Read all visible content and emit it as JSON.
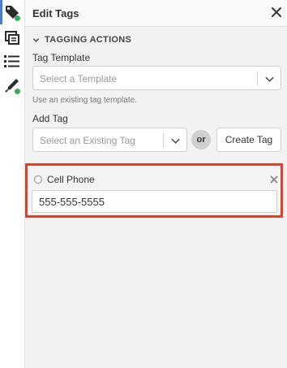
{
  "rail": {
    "items": [
      {
        "icon": "tag-icon",
        "active": true,
        "dot": true
      },
      {
        "icon": "layers-icon",
        "active": false,
        "dot": false
      },
      {
        "icon": "list-icon",
        "active": false,
        "dot": false
      },
      {
        "icon": "pen-icon",
        "active": false,
        "dot": true
      }
    ],
    "accent_color": "#4a7fc1",
    "dot_color": "#3caa5a"
  },
  "header": {
    "title": "Edit Tags",
    "close_icon": "close-icon"
  },
  "section": {
    "title": "TAGGING ACTIONS",
    "expanded": true
  },
  "tag_template": {
    "label": "Tag Template",
    "placeholder": "Select a Template",
    "hint": "Use an existing tag template."
  },
  "add_tag": {
    "label": "Add Tag",
    "placeholder": "Select an Existing Tag",
    "or_text": "or",
    "create_label": "Create Tag"
  },
  "tag_item": {
    "name": "Cell Phone",
    "value": "555-555-5555",
    "highlight_color": "#e0402a"
  }
}
